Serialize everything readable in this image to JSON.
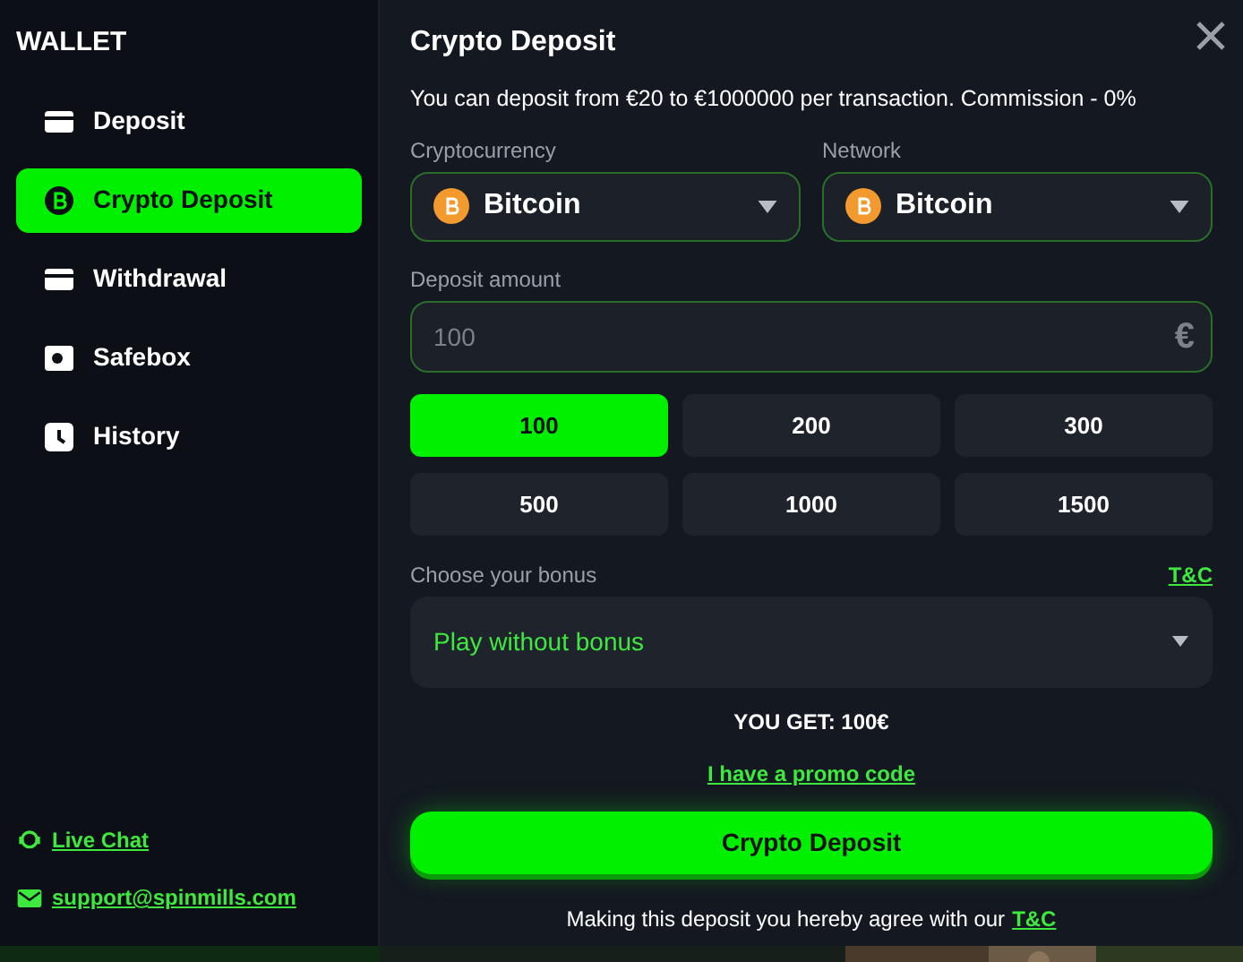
{
  "sidebar": {
    "title": "WALLET",
    "items": [
      {
        "label": "Deposit",
        "kind": "card-up",
        "selected": false
      },
      {
        "label": "Crypto Deposit",
        "kind": "bitcoin",
        "selected": true
      },
      {
        "label": "Withdrawal",
        "kind": "card-down",
        "selected": false
      },
      {
        "label": "Safebox",
        "kind": "safe",
        "selected": false
      },
      {
        "label": "History",
        "kind": "clock",
        "selected": false
      }
    ],
    "links": [
      {
        "label": "Live Chat",
        "kind": "chat"
      },
      {
        "label": "support@spinmills.com",
        "kind": "mail"
      }
    ]
  },
  "dialog": {
    "title": "Crypto Deposit",
    "info": "You can deposit from €20 to €1000000 per transaction. Commission - 0%",
    "selects": [
      {
        "label": "Cryptocurrency",
        "value": "Bitcoin"
      },
      {
        "label": "Network",
        "value": "Bitcoin"
      }
    ],
    "amount": {
      "label": "Deposit amount",
      "placeholder": "100",
      "currency": "€"
    },
    "presets": [
      {
        "label": "100",
        "selected": true
      },
      {
        "label": "200",
        "selected": false
      },
      {
        "label": "300",
        "selected": false
      },
      {
        "label": "500",
        "selected": false
      },
      {
        "label": "1000",
        "selected": false
      },
      {
        "label": "1500",
        "selected": false
      }
    ],
    "bonus": {
      "label": "Choose your bonus",
      "terms_link": "T&C",
      "value": "Play without bonus"
    },
    "you_get": "YOU GET: 100€",
    "promo_link": "I have a promo code",
    "submit": "Crypto Deposit",
    "agreement": "Making this deposit you hereby agree with our",
    "agreement_link": "T&C"
  }
}
